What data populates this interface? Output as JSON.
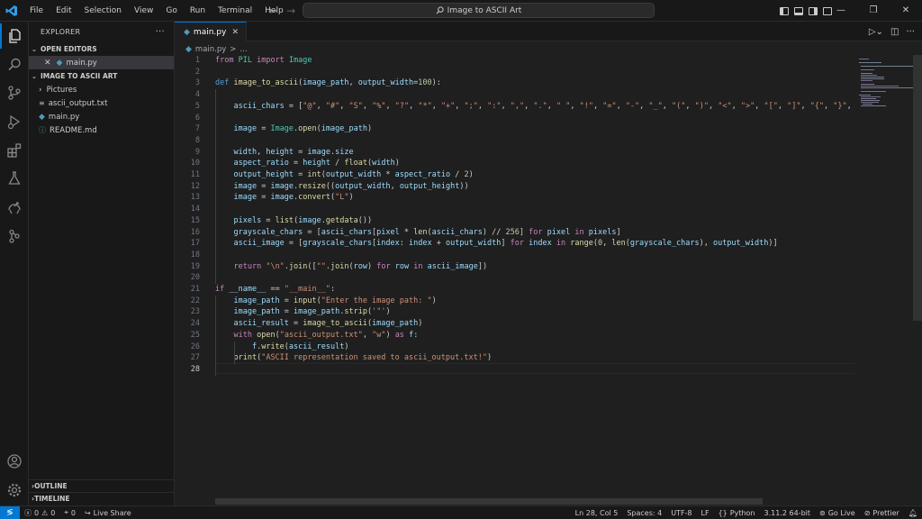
{
  "titlebar": {
    "menu": [
      "File",
      "Edit",
      "Selection",
      "View",
      "Go",
      "Run",
      "Terminal",
      "Help"
    ],
    "search_text": "Image to ASCII Art"
  },
  "sidebar": {
    "title": "EXPLORER",
    "more": "···",
    "open_editors_label": "OPEN EDITORS",
    "open_editor_file": "main.py",
    "folder_label": "IMAGE TO ASCII ART",
    "items": [
      "Pictures",
      "ascii_output.txt",
      "main.py",
      "README.md"
    ],
    "outline_label": "OUTLINE",
    "timeline_label": "TIMELINE"
  },
  "editor": {
    "tab_label": "main.py",
    "breadcrumb_file": "main.py",
    "breadcrumb_sep": ">",
    "breadcrumb_rest": "...",
    "lines": [
      "from PIL import Image",
      "",
      "def image_to_ascii(image_path, output_width=100):",
      "",
      "    ascii_chars = [\"@\", \"#\", \"S\", \"%\", \"?\", \"*\", \"+\", \";\", \":\", \",\", \".\", \" \", \"!\", \"=\", \"-\", \"_\", \"(\", \")\", \"<\", \">\", \"[\", \"]\", \"{\", \"}\",",
      "",
      "    image = Image.open(image_path)",
      "",
      "    width, height = image.size",
      "    aspect_ratio = height / float(width)",
      "    output_height = int(output_width * aspect_ratio / 2)",
      "    image = image.resize((output_width, output_height))",
      "    image = image.convert(\"L\")",
      "",
      "    pixels = list(image.getdata())",
      "    grayscale_chars = [ascii_chars[pixel * len(ascii_chars) // 256] for pixel in pixels]",
      "    ascii_image = [grayscale_chars[index: index + output_width] for index in range(0, len(grayscale_chars), output_width)]",
      "",
      "    return \"\\n\".join([\"\".join(row) for row in ascii_image])",
      "",
      "if __name__ == \"__main__\":",
      "    image_path = input(\"Enter the image path: \")",
      "    image_path = image_path.strip('\"')",
      "    ascii_result = image_to_ascii(image_path)",
      "    with open(\"ascii_output.txt\", \"w\") as f:",
      "        f.write(ascii_result)",
      "    print(\"ASCII representation saved to ascii_output.txt!\")",
      ""
    ],
    "current_line": 28
  },
  "statusbar": {
    "errors": "0",
    "warnings": "0",
    "ports": "0",
    "live_share": "Live Share",
    "position": "Ln 28, Col 5",
    "spaces": "Spaces: 4",
    "encoding": "UTF-8",
    "eol": "LF",
    "language": "Python",
    "interpreter": "3.11.2 64-bit",
    "go_live": "Go Live",
    "prettier": "Prettier"
  },
  "colors": {
    "keyword": "#c586c0",
    "function": "#dcdcaa",
    "variable": "#9cdcfe",
    "string": "#ce9178",
    "number": "#b5cea8",
    "class": "#4ec9b0",
    "accent": "#0078d4"
  }
}
